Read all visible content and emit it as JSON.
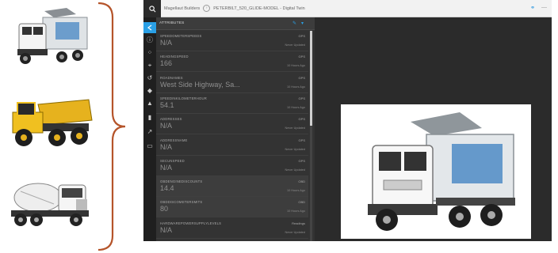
{
  "breadcrumb": {
    "root": "Magellaut Builders",
    "asset": "PETERBILT_520_GLIDE-MODEL - Digital Twin"
  },
  "panel": {
    "title": "ATTRIBUTES"
  },
  "attributes": [
    {
      "name": "SPEEDOMETERSPEEDS",
      "value": "N/A",
      "source": "GPS",
      "updated": "Never Updated"
    },
    {
      "name": "HEADINGSPEED",
      "value": "166",
      "source": "GPS",
      "updated": "10 Hours Ago"
    },
    {
      "name": "ROADNAMES",
      "value": "West Side Highway, Sa...",
      "source": "GPS",
      "updated": "10 Hours Ago"
    },
    {
      "name": "SPEEDINKILOMETERHOUR",
      "value": "54.1",
      "source": "GPS",
      "updated": "10 Hours Ago"
    },
    {
      "name": "ADDRESSES",
      "value": "N/A",
      "source": "GPS",
      "updated": "Never Updated"
    },
    {
      "name": "ADDRESSNAME",
      "value": "N/A",
      "source": "GPS",
      "updated": "Never Updated"
    },
    {
      "name": "SECUNSPEED",
      "value": "N/A",
      "source": "GPS",
      "updated": "Never Updated"
    },
    {
      "name": "OBDENGINEDISCOUNTS",
      "value": "14.4",
      "source": "OBD",
      "updated": "10 Hours Ago"
    },
    {
      "name": "OBDDISCOMETERSMITS",
      "value": "80",
      "source": "OBD",
      "updated": "10 Hours Ago"
    },
    {
      "name": "HARDWAREPOWERSUPPLYLEVELS",
      "value": "N/A",
      "source": "Readings",
      "updated": "Never Updated"
    }
  ],
  "highlighted_rows": [
    7,
    8
  ],
  "icons": {
    "rail": [
      "info-icon",
      "network-icon",
      "tag-icon",
      "history-icon",
      "settings-diamond-icon",
      "warning-icon",
      "bar-chart-icon",
      "trend-icon",
      "chat-icon"
    ],
    "toolbar": [
      "link-icon",
      "minimize-icon"
    ]
  },
  "colors": {
    "accent": "#2aa0e6",
    "panel": "#333333",
    "brace": "#b5542a"
  }
}
